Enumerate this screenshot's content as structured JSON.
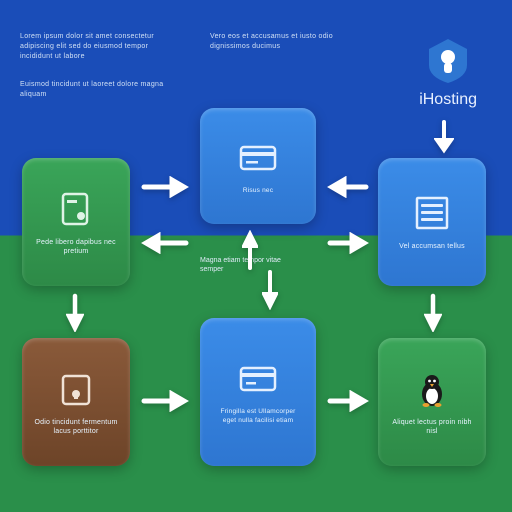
{
  "header": {
    "left_block": "Lorem ipsum dolor sit amet consectetur\nadipiscing elit sed do eiusmod\ntempor incididunt ut labore",
    "left_sub": "Euismod tincidunt ut laoreet dolore magna aliquam",
    "center_block": "Vero eos et accusamus et iusto\nodio dignissimos ducimus"
  },
  "brand": {
    "label": "iHosting"
  },
  "nodes": {
    "green_top": {
      "label": "Pede libero dapibus\nnec pretium"
    },
    "blue_top": {
      "label": "Risus nec"
    },
    "blue_right": {
      "label": "Vel accumsan\ntellus"
    },
    "brown": {
      "label": "Odio tincidunt\nfermentum lacus\nporttitor"
    },
    "blue_center": {
      "label": "Fringilla est\nUllamcorper eget nulla\nfacilisi etiam"
    },
    "green_bottom": {
      "label": "Aliquet lectus proin\nnibh nisl"
    }
  },
  "captions": {
    "mid": "Magna etiam tempor\nvitae semper"
  },
  "colors": {
    "green": "#2d8a47",
    "blue": "#2e76d1",
    "brown": "#6d4428",
    "bg_top": "#1a4db8"
  }
}
